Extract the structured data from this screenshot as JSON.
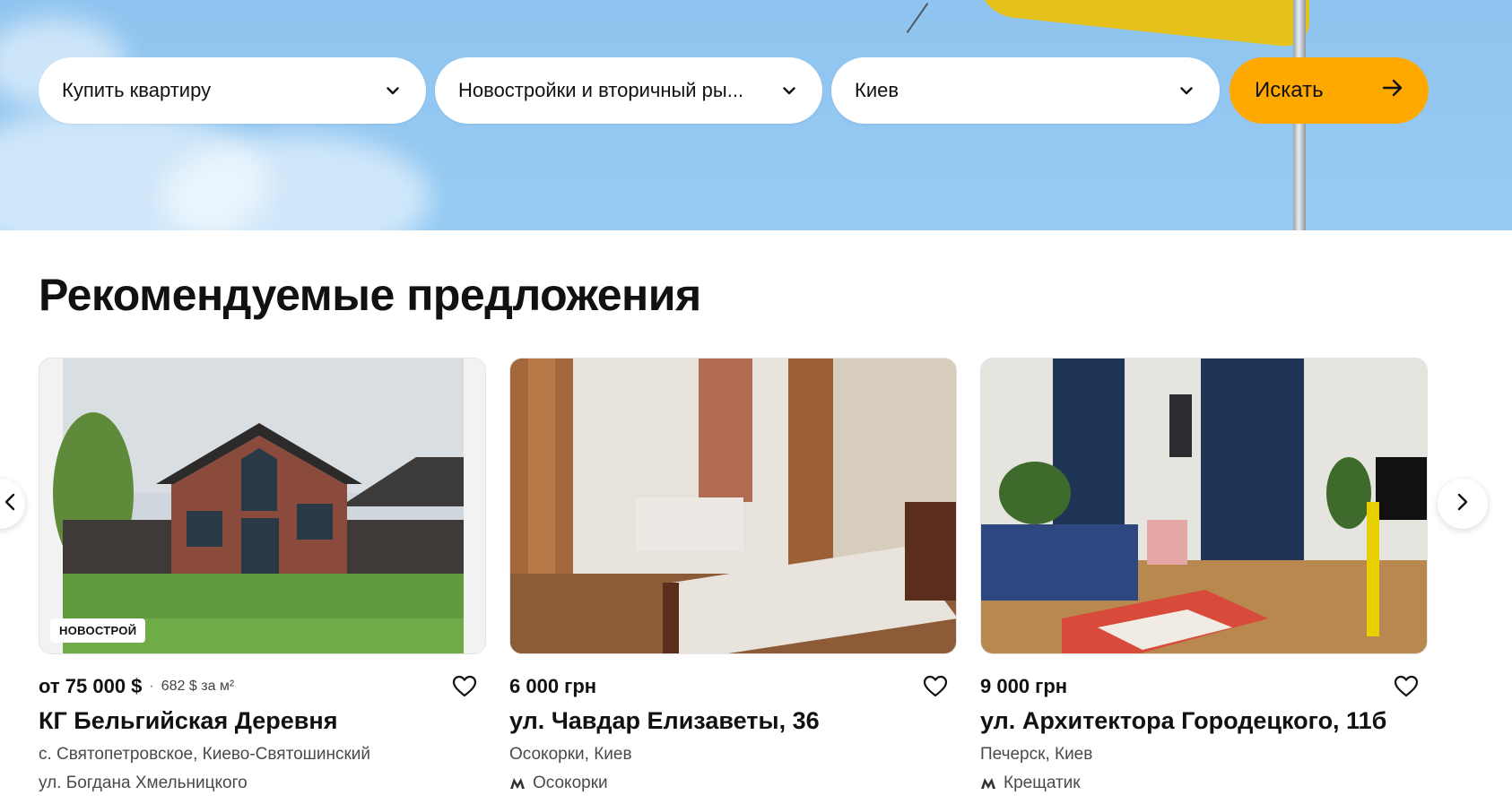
{
  "search": {
    "deal_type": "Купить квартиру",
    "market": "Новостройки и вторичный ры...",
    "city": "Киев",
    "submit_label": "Искать"
  },
  "section": {
    "title": "Рекомендуемые предложения"
  },
  "colors": {
    "accent": "#ffa900",
    "sky": "#8fc4f0",
    "text": "#111111",
    "muted": "#4a4a4a"
  },
  "icons": {
    "dropdown": "chevron-down-icon",
    "submit": "arrow-right-icon",
    "favorite": "heart-icon",
    "metro": "metro-icon",
    "prev": "chevron-left-icon",
    "next": "chevron-right-icon"
  },
  "listings": [
    {
      "badge": "НОВОСТРОЙ",
      "price": "от 75 000 $",
      "price_separator": "·",
      "price_per_m2": "682 $ за м²",
      "title": "КГ Бельгийская Деревня",
      "location": "с. Святопетровское, Киево-Святошинский",
      "address": "ул. Богдана Хмельницкого"
    },
    {
      "price": "6 000 грн",
      "title": "ул. Чавдар Елизаветы, 36",
      "location": "Осокорки, Киев",
      "metro": "Осокорки"
    },
    {
      "price": "9 000 грн",
      "title": "ул. Архитектора Городецкого, 11б",
      "location": "Печерск, Киев",
      "metro": "Крещатик"
    }
  ]
}
